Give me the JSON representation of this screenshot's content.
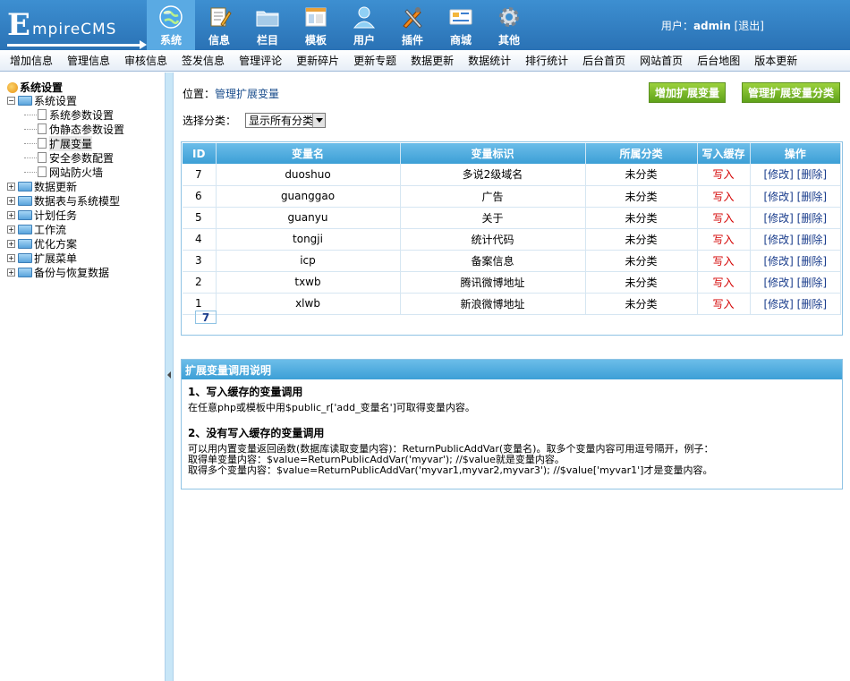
{
  "logo": {
    "big": "E",
    "small": "mpireCMS"
  },
  "nav": [
    {
      "label": "系统",
      "icon": "globe-icon",
      "active": true
    },
    {
      "label": "信息",
      "icon": "notepad-icon"
    },
    {
      "label": "栏目",
      "icon": "folder-icon"
    },
    {
      "label": "模板",
      "icon": "window-icon"
    },
    {
      "label": "用户",
      "icon": "user-icon"
    },
    {
      "label": "插件",
      "icon": "tools-icon"
    },
    {
      "label": "商城",
      "icon": "card-icon"
    },
    {
      "label": "其他",
      "icon": "gear-icon"
    }
  ],
  "user": {
    "prefix": "用户：",
    "name": "admin",
    "logout": "[退出]"
  },
  "subnav": [
    "增加信息",
    "管理信息",
    "审核信息",
    "签发信息",
    "管理评论",
    "更新碎片",
    "更新专题",
    "数据更新",
    "数据统计",
    "排行统计",
    "后台首页",
    "网站首页",
    "后台地图",
    "版本更新"
  ],
  "sidebar": {
    "title": "系统设置",
    "tree": [
      {
        "label": "系统设置",
        "type": "folder",
        "pm": "−"
      },
      {
        "label": "系统参数设置",
        "type": "page"
      },
      {
        "label": "伪静态参数设置",
        "type": "page"
      },
      {
        "label": "扩展变量",
        "type": "page",
        "selected": true
      },
      {
        "label": "安全参数配置",
        "type": "page"
      },
      {
        "label": "网站防火墙",
        "type": "page"
      },
      {
        "label": "数据更新",
        "type": "folder",
        "pm": "+"
      },
      {
        "label": "数据表与系统模型",
        "type": "folder",
        "pm": "+"
      },
      {
        "label": "计划任务",
        "type": "folder",
        "pm": "+"
      },
      {
        "label": "工作流",
        "type": "folder",
        "pm": "+"
      },
      {
        "label": "优化方案",
        "type": "folder",
        "pm": "+"
      },
      {
        "label": "扩展菜单",
        "type": "folder",
        "pm": "+"
      },
      {
        "label": "备份与恢复数据",
        "type": "folder",
        "pm": "+"
      }
    ]
  },
  "location": {
    "prefix": "位置：",
    "link": "管理扩展变量"
  },
  "buttons": {
    "add": "增加扩展变量",
    "manage_class": "管理扩展变量分类"
  },
  "filter": {
    "label": "选择分类：",
    "selected": "显示所有分类"
  },
  "table": {
    "headers": [
      "ID",
      "变量名",
      "变量标识",
      "所属分类",
      "写入缓存",
      "操作"
    ],
    "rows": [
      {
        "id": "7",
        "name": "duoshuo",
        "mark": "多说2级域名",
        "cat": "未分类",
        "cache": "写入"
      },
      {
        "id": "6",
        "name": "guanggao",
        "mark": "广告",
        "cat": "未分类",
        "cache": "写入"
      },
      {
        "id": "5",
        "name": "guanyu",
        "mark": "关于",
        "cat": "未分类",
        "cache": "写入"
      },
      {
        "id": "4",
        "name": "tongji",
        "mark": "统计代码",
        "cat": "未分类",
        "cache": "写入"
      },
      {
        "id": "3",
        "name": "icp",
        "mark": "备案信息",
        "cat": "未分类",
        "cache": "写入"
      },
      {
        "id": "2",
        "name": "txwb",
        "mark": "腾讯微博地址",
        "cat": "未分类",
        "cache": "写入"
      },
      {
        "id": "1",
        "name": "xlwb",
        "mark": "新浪微博地址",
        "cat": "未分类",
        "cache": "写入"
      }
    ],
    "edit": "[修改]",
    "delete": "[删除]",
    "page_total": "7"
  },
  "help": {
    "title": "扩展变量调用说明",
    "s1_title": "1、写入缓存的变量调用",
    "s1_text": "在任意php或模板中用$public_r['add_变量名']可取得变量内容。",
    "s2_title": "2、没有写入缓存的变量调用",
    "s2_line1": "可以用内置变量返回函数(数据库读取变量内容)：ReturnPublicAddVar(变量名)。取多个变量内容可用逗号隔开，例子：",
    "s2_line2": "取得单变量内容：$value=ReturnPublicAddVar('myvar'); //$value就是变量内容。",
    "s2_line3": "取得多个变量内容：$value=ReturnPublicAddVar('myvar1,myvar2,myvar3'); //$value['myvar1']才是变量内容。"
  }
}
